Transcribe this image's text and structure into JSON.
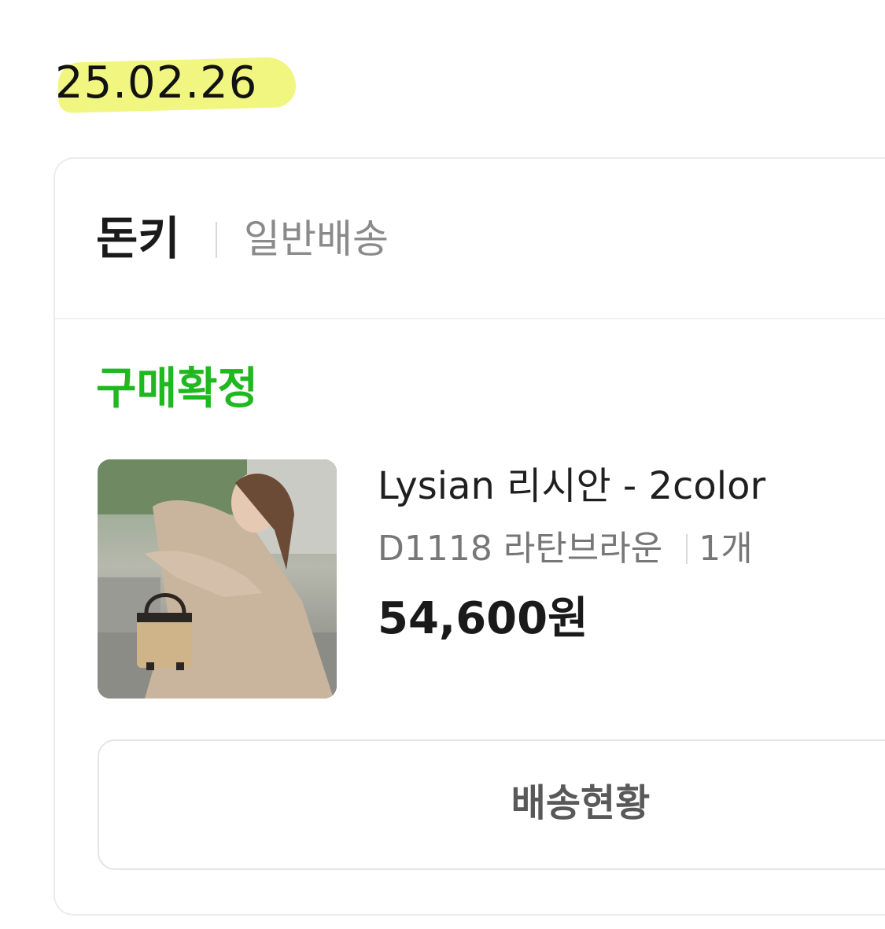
{
  "order_date": "25.02.26",
  "colors": {
    "accent_green": "#1fb81f",
    "highlight_yellow": "#eef56a"
  },
  "seller": {
    "name": "돈키",
    "shipping_type": "일반배송"
  },
  "order": {
    "status": "구매확정",
    "product": {
      "image_icon": "product-photo",
      "title": "Lysian 리시안 - 2color",
      "option": "D1118 라탄브라운",
      "quantity": "1개",
      "price": "54,600원"
    }
  },
  "actions": {
    "track_label": "배송현황"
  }
}
